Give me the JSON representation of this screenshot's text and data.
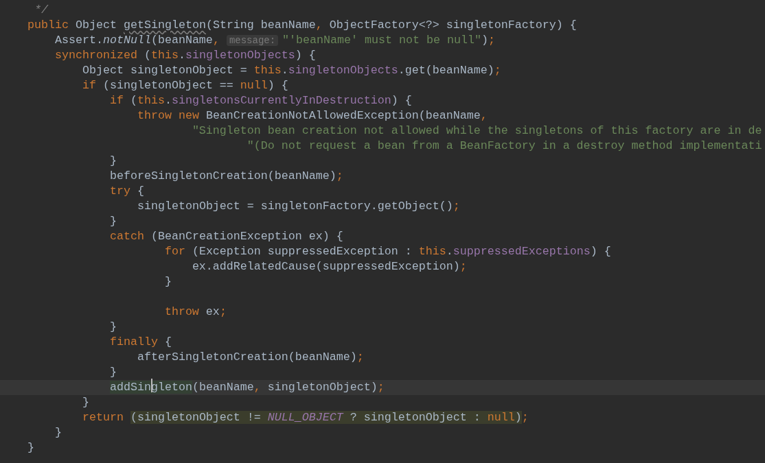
{
  "editor": {
    "lines": [
      {
        "tokens": [
          {
            "text": "     */",
            "kind": "comment"
          }
        ]
      },
      {
        "tokens": [
          {
            "text": "    public",
            "kind": "keyword"
          },
          {
            "text": " Object ",
            "kind": "plain"
          },
          {
            "text": "getSingleton",
            "kind": "warned"
          },
          {
            "text": "(String beanName",
            "kind": "plain"
          },
          {
            "text": ",",
            "kind": "punct"
          },
          {
            "text": " ObjectFactory<?> singletonFactory) {",
            "kind": "plain"
          }
        ]
      },
      {
        "tokens": [
          {
            "text": "        Assert.",
            "kind": "plain"
          },
          {
            "text": "notNull",
            "kind": "static"
          },
          {
            "text": "(beanName",
            "kind": "plain"
          },
          {
            "text": ",",
            "kind": "punct"
          },
          {
            "text": "message:",
            "kind": "hint"
          },
          {
            "text": "\"'beanName' must not be null\"",
            "kind": "string"
          },
          {
            "text": ")",
            "kind": "plain"
          },
          {
            "text": ";",
            "kind": "punct"
          }
        ]
      },
      {
        "tokens": [
          {
            "text": "        synchronized",
            "kind": "keyword"
          },
          {
            "text": " (",
            "kind": "plain"
          },
          {
            "text": "this",
            "kind": "keyword"
          },
          {
            "text": ".",
            "kind": "plain"
          },
          {
            "text": "singletonObjects",
            "kind": "field"
          },
          {
            "text": ") {",
            "kind": "plain"
          }
        ]
      },
      {
        "tokens": [
          {
            "text": "            Object singletonObject = ",
            "kind": "plain"
          },
          {
            "text": "this",
            "kind": "keyword"
          },
          {
            "text": ".",
            "kind": "plain"
          },
          {
            "text": "singletonObjects",
            "kind": "field"
          },
          {
            "text": ".get(beanName)",
            "kind": "plain"
          },
          {
            "text": ";",
            "kind": "punct"
          }
        ]
      },
      {
        "tokens": [
          {
            "text": "            if",
            "kind": "keyword"
          },
          {
            "text": " (singletonObject == ",
            "kind": "plain"
          },
          {
            "text": "null",
            "kind": "keyword"
          },
          {
            "text": ") {",
            "kind": "plain"
          }
        ]
      },
      {
        "tokens": [
          {
            "text": "                if",
            "kind": "keyword"
          },
          {
            "text": " (",
            "kind": "plain"
          },
          {
            "text": "this",
            "kind": "keyword"
          },
          {
            "text": ".",
            "kind": "plain"
          },
          {
            "text": "singletonsCurrentlyInDestruction",
            "kind": "field"
          },
          {
            "text": ") {",
            "kind": "plain"
          }
        ]
      },
      {
        "tokens": [
          {
            "text": "                    throw",
            "kind": "keyword"
          },
          {
            "text": " new",
            "kind": "keyword"
          },
          {
            "text": " BeanCreationNotAllowedException(beanName",
            "kind": "plain"
          },
          {
            "text": ",",
            "kind": "punct"
          }
        ]
      },
      {
        "tokens": [
          {
            "text": "                            \"Singleton bean creation not allowed while the singletons of this factory are in de",
            "kind": "string"
          }
        ]
      },
      {
        "tokens": [
          {
            "text": "                                    \"(Do not request a bean from a BeanFactory in a destroy method implementati",
            "kind": "string"
          }
        ]
      },
      {
        "tokens": [
          {
            "text": "                }",
            "kind": "plain"
          }
        ]
      },
      {
        "tokens": [
          {
            "text": "                beforeSingletonCreation(beanName)",
            "kind": "plain"
          },
          {
            "text": ";",
            "kind": "punct"
          }
        ]
      },
      {
        "tokens": [
          {
            "text": "                try",
            "kind": "keyword"
          },
          {
            "text": " {",
            "kind": "plain"
          }
        ]
      },
      {
        "tokens": [
          {
            "text": "                    singletonObject = singletonFactory.getObject()",
            "kind": "plain"
          },
          {
            "text": ";",
            "kind": "punct"
          }
        ]
      },
      {
        "tokens": [
          {
            "text": "                }",
            "kind": "plain"
          }
        ]
      },
      {
        "tokens": [
          {
            "text": "                catch",
            "kind": "keyword"
          },
          {
            "text": " (BeanCreationException ex) {",
            "kind": "plain"
          }
        ]
      },
      {
        "tokens": [
          {
            "text": "                        for",
            "kind": "keyword"
          },
          {
            "text": " (Exception suppressedException : ",
            "kind": "plain"
          },
          {
            "text": "this",
            "kind": "keyword"
          },
          {
            "text": ".",
            "kind": "plain"
          },
          {
            "text": "suppressedExceptions",
            "kind": "field"
          },
          {
            "text": ") {",
            "kind": "plain"
          }
        ]
      },
      {
        "tokens": [
          {
            "text": "                            ex.addRelatedCause(suppressedException)",
            "kind": "plain"
          },
          {
            "text": ";",
            "kind": "punct"
          }
        ]
      },
      {
        "tokens": [
          {
            "text": "                        }",
            "kind": "plain"
          }
        ]
      },
      {
        "blank_line_before": true,
        "tokens": [
          {
            "text": "                        throw",
            "kind": "keyword"
          },
          {
            "text": " ex",
            "kind": "plain"
          },
          {
            "text": ";",
            "kind": "punct"
          }
        ]
      },
      {
        "tokens": [
          {
            "text": "                }",
            "kind": "plain"
          }
        ]
      },
      {
        "tokens": [
          {
            "text": "                finally",
            "kind": "keyword"
          },
          {
            "text": " {",
            "kind": "plain"
          }
        ]
      },
      {
        "tokens": [
          {
            "text": "                    afterSingletonCreation(beanName)",
            "kind": "plain"
          },
          {
            "text": ";",
            "kind": "punct"
          }
        ]
      },
      {
        "tokens": [
          {
            "text": "                }",
            "kind": "plain"
          }
        ]
      },
      {
        "current": true,
        "tokens": [
          {
            "kind": "usage",
            "parts": [
              "                addSin",
              "gleton"
            ]
          },
          {
            "text": "(beanName",
            "kind": "plain"
          },
          {
            "text": ",",
            "kind": "punct"
          },
          {
            "text": " singletonObject)",
            "kind": "plain"
          },
          {
            "text": ";",
            "kind": "punct"
          }
        ]
      },
      {
        "tokens": [
          {
            "text": "            }",
            "kind": "plain"
          }
        ]
      },
      {
        "tokens": [
          {
            "text": "            return ",
            "kind": "keyword"
          },
          {
            "kind": "match",
            "parts": [
              {
                "text": "(singletonObject != ",
                "kind": "plain"
              },
              {
                "text": "NULL_OBJECT",
                "kind": "constant"
              },
              {
                "text": " ? singletonObject : ",
                "kind": "plain"
              },
              {
                "text": "null",
                "kind": "keyword"
              },
              {
                "text": ")",
                "kind": "plain"
              }
            ]
          },
          {
            "text": ";",
            "kind": "punct"
          }
        ]
      },
      {
        "tokens": [
          {
            "text": "        }",
            "kind": "plain"
          }
        ]
      },
      {
        "tokens": [
          {
            "text": "    }",
            "kind": "plain"
          }
        ]
      }
    ]
  }
}
